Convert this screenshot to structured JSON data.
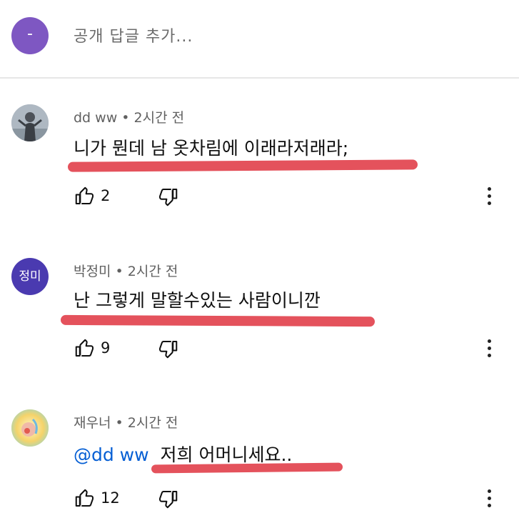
{
  "add_comment": {
    "avatar_glyph": "-",
    "placeholder": "공개 답글 추가..."
  },
  "comments": [
    {
      "author": "dd ww",
      "time": "2시간 전",
      "text": "니가 뭔데 남 옷차림에 이래라저래라;",
      "likes": "2"
    },
    {
      "author": "박정미",
      "avatar_text": "정미",
      "time": "2시간 전",
      "text": "난 그렇게 말할수있는 사람이니깐",
      "likes": "9"
    },
    {
      "author": "재우너",
      "time": "2시간 전",
      "mention": "@dd ww",
      "text": "저희 어머니세요..",
      "likes": "12"
    }
  ],
  "colors": {
    "avatar_purple": "#7e57c2",
    "avatar_indigo": "#4a3ab0",
    "highlight_red": "#e03a45",
    "mention_blue": "#065fd4"
  },
  "icons": [
    "thumbs-up-icon",
    "thumbs-down-icon",
    "more-vert-icon"
  ],
  "separator": " • "
}
